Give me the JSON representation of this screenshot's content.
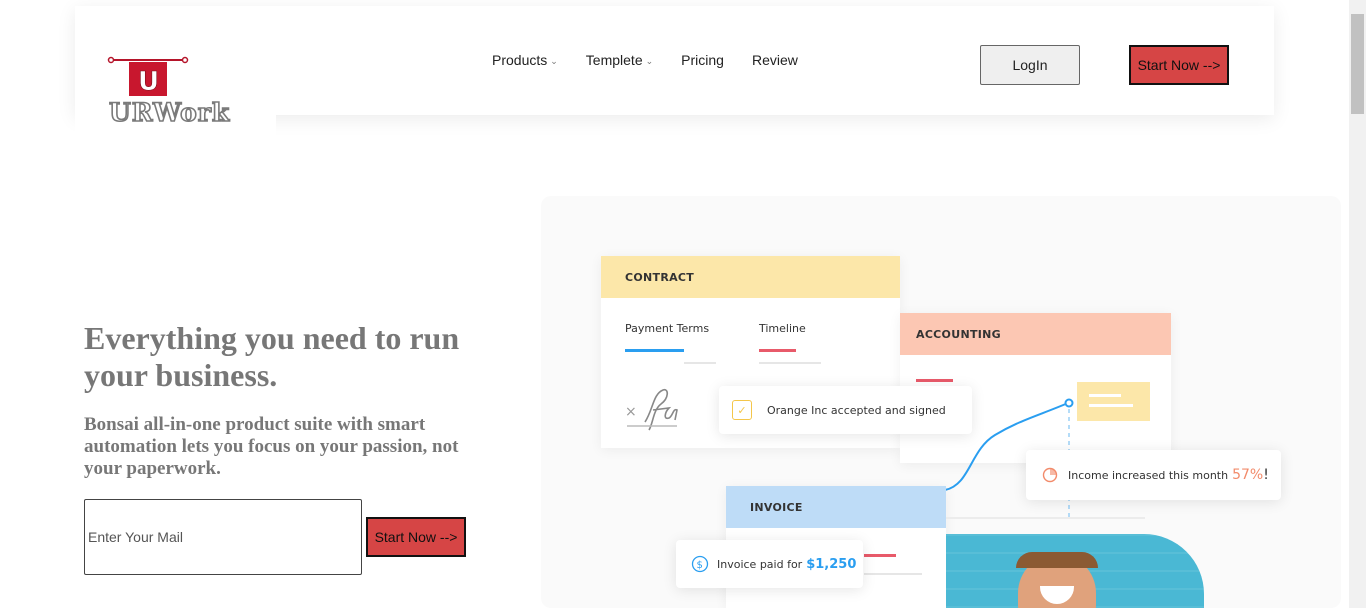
{
  "brand": {
    "logo_text": "URWork",
    "logo_letter": "U"
  },
  "nav": {
    "items": [
      {
        "label": "Products",
        "has_dropdown": true
      },
      {
        "label": "Templete",
        "has_dropdown": true
      },
      {
        "label": "Pricing",
        "has_dropdown": false
      },
      {
        "label": "Review",
        "has_dropdown": false
      }
    ],
    "login_label": "LogIn",
    "start_label": "Start Now -->"
  },
  "hero": {
    "title": "Everything you need to run your business.",
    "subtitle": "Bonsai all-in-one product suite with smart automation lets you focus on your passion, not your paperwork.",
    "email_placeholder": "Enter Your Mail",
    "start_label": "Start Now -->"
  },
  "illustration": {
    "contract": {
      "header": "CONTRACT",
      "tab1": "Payment Terms",
      "tab2": "Timeline"
    },
    "accounting": {
      "header": "ACCOUNTING"
    },
    "invoice": {
      "header": "INVOICE"
    },
    "toast_signed": "Orange Inc accepted and signed",
    "toast_income_text": "Income increased this month",
    "toast_income_value": "57%",
    "toast_income_suffix": "!",
    "toast_paid_text": "Invoice paid for",
    "toast_paid_value": "$1,250"
  },
  "colors": {
    "accent_red": "#d64545",
    "contract_yellow": "#fce7a9",
    "accounting_peach": "#fcc7b3",
    "invoice_blue": "#bedcf7",
    "text_gray": "#777777",
    "link_blue": "#2a9ef0",
    "orange_percent": "#f28b6b"
  }
}
